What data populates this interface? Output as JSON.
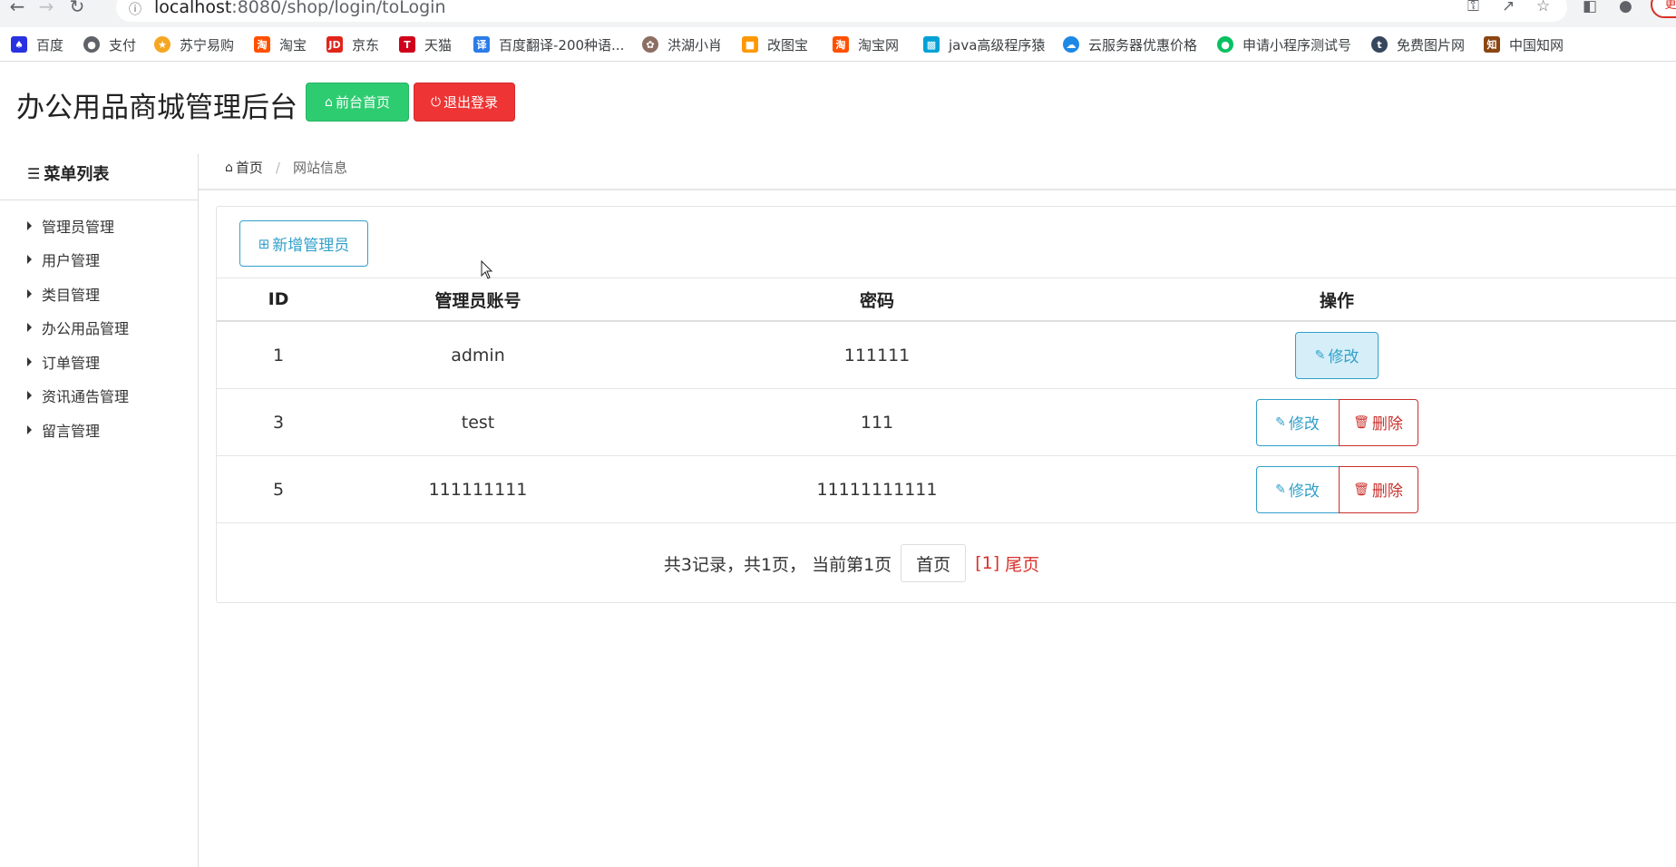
{
  "browser": {
    "url_host": "localhost",
    "url_path": ":8080/shop/login/toLogin",
    "update_label": "更",
    "bookmarks": [
      {
        "label": "百度",
        "icon": "baidu-icon",
        "color": "#2932e1"
      },
      {
        "label": "支付",
        "icon": "globe-icon",
        "color": "#5f6368"
      },
      {
        "label": "苏宁易购",
        "icon": "suning-icon",
        "color": "#f5a623"
      },
      {
        "label": "淘宝",
        "icon": "taobao-icon",
        "color": "#ff5000"
      },
      {
        "label": "京东",
        "icon": "jd-icon",
        "color": "#e1251b"
      },
      {
        "label": "天猫",
        "icon": "tmall-icon",
        "color": "#d0021b"
      },
      {
        "label": "百度翻译-200种语...",
        "icon": "translate-icon",
        "color": "#2b7ce9"
      },
      {
        "label": "洪湖小肖",
        "icon": "bird-icon",
        "color": "#8d6e63"
      },
      {
        "label": "改图宝",
        "icon": "gaitubao-icon",
        "color": "#ff9800"
      },
      {
        "label": "淘宝网",
        "icon": "taobao-icon",
        "color": "#ff5000"
      },
      {
        "label": "java高级程序猿",
        "icon": "bilibili-icon",
        "color": "#00a1d6"
      },
      {
        "label": "云服务器优惠价格",
        "icon": "cloud-icon",
        "color": "#1e88e5"
      },
      {
        "label": "申请小程序测试号",
        "icon": "wechat-icon",
        "color": "#07c160"
      },
      {
        "label": "免费图片网",
        "icon": "tumblr-icon",
        "color": "#36465d"
      },
      {
        "label": "中国知网",
        "icon": "cnki-icon",
        "color": "#8b4513"
      }
    ]
  },
  "header": {
    "title": "办公用品商城管理后台",
    "front_label": "前台首页",
    "logout_label": "退出登录",
    "colors": {
      "front": "#2ecc71",
      "logout": "#ee3434"
    }
  },
  "sidebar": {
    "title": "菜单列表",
    "items": [
      {
        "label": "管理员管理"
      },
      {
        "label": "用户管理"
      },
      {
        "label": "类目管理"
      },
      {
        "label": "办公用品管理"
      },
      {
        "label": "订单管理"
      },
      {
        "label": "资讯通告管理"
      },
      {
        "label": "留言管理"
      }
    ]
  },
  "breadcrumb": {
    "home": "首页",
    "current": "网站信息"
  },
  "main": {
    "add_label": "新增管理员",
    "table": {
      "headers": [
        "ID",
        "管理员账号",
        "密码",
        "操作"
      ],
      "rows": [
        {
          "id": "1",
          "account": "admin",
          "password": "111111",
          "can_delete": false
        },
        {
          "id": "3",
          "account": "test",
          "password": "111",
          "can_delete": true
        },
        {
          "id": "5",
          "account": "111111111",
          "password": "11111111111",
          "can_delete": true
        }
      ],
      "edit_label": "修改",
      "delete_label": "删除"
    },
    "pager": {
      "summary": "共3记录，共1页， 当前第1页",
      "first_label": "首页",
      "current_label": "[1]",
      "last_label": "尾页"
    }
  }
}
